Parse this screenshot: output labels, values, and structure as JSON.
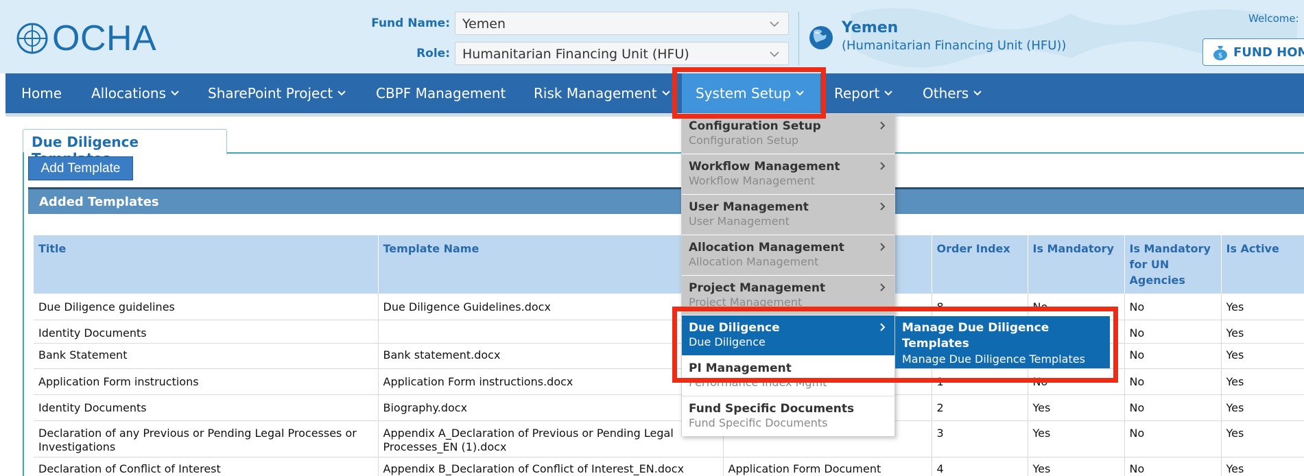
{
  "header": {
    "logo_text": "OCHA",
    "fund_label": "Fund Name:",
    "fund_value": "Yemen",
    "role_label": "Role:",
    "role_value": "Humanitarian Financing Unit (HFU)",
    "country_name": "Yemen",
    "country_role": "(Humanitarian Financing Unit (HFU))",
    "welcome": "Welcome:",
    "fund_home": "FUND HOM"
  },
  "nav": {
    "items": [
      {
        "label": "Home"
      },
      {
        "label": "Allocations"
      },
      {
        "label": "SharePoint Project"
      },
      {
        "label": "CBPF Management"
      },
      {
        "label": "Risk Management"
      },
      {
        "label": "System Setup"
      },
      {
        "label": "Report"
      },
      {
        "label": "Others"
      }
    ]
  },
  "page": {
    "tab_title": "Due Diligence Templates",
    "add_button": "Add Template",
    "section_title": "Added Templates"
  },
  "table": {
    "headers": [
      "Title",
      "Template Name",
      "",
      "Order Index",
      "Is Mandatory",
      "Is Mandatory for UN Agencies",
      "Is Active"
    ],
    "rows": [
      [
        "Due Diligence guidelines",
        "Due Diligence Guidelines.docx",
        "",
        "8",
        "No",
        "No",
        "Yes"
      ],
      [
        "Identity Documents",
        "",
        "",
        "",
        "",
        "No",
        "Yes"
      ],
      [
        "Bank Statement",
        "Bank statement.docx",
        "",
        "",
        "",
        "No",
        "Yes"
      ],
      [
        "Application Form instructions",
        "Application Form instructions.docx",
        "",
        "1",
        "No",
        "No",
        "Yes"
      ],
      [
        "Identity Documents",
        "Biography.docx",
        "",
        "2",
        "Yes",
        "No",
        "Yes"
      ],
      [
        "Declaration of any Previous or Pending Legal Processes or Investigations",
        "Appendix A_Declaration of Previous or Pending Legal Processes_EN (1).docx",
        "",
        "3",
        "Yes",
        "No",
        "Yes"
      ],
      [
        "Declaration of Conflict of Interest",
        "Appendix B_Declaration of Conflict of Interest_EN.docx",
        "Application Form Document",
        "4",
        "Yes",
        "No",
        "Yes"
      ]
    ]
  },
  "dropdown": {
    "items": [
      {
        "title": "Configuration Setup",
        "sub": "Configuration Setup"
      },
      {
        "title": "Workflow Management",
        "sub": "Workflow Management"
      },
      {
        "title": "User Management",
        "sub": "User Management"
      },
      {
        "title": "Allocation Management",
        "sub": "Allocation Management"
      },
      {
        "title": "Project Management",
        "sub": "Project Management"
      },
      {
        "title": "Due Diligence",
        "sub": "Due Diligence"
      },
      {
        "title": "PI Management",
        "sub": "Performance Index Mgmt"
      },
      {
        "title": "Fund Specific Documents",
        "sub": "Fund Specific Documents"
      }
    ],
    "submenu": {
      "title": "Manage Due Diligence Templates",
      "sub": "Manage Due Diligence Templates"
    }
  },
  "colors": {
    "nav_bg": "#2a6aac",
    "nav_active": "#3f94dc",
    "accent_blue": "#1d6fb0",
    "menu_selected": "#0f6ab0",
    "annotation_red": "#ee2b15"
  }
}
